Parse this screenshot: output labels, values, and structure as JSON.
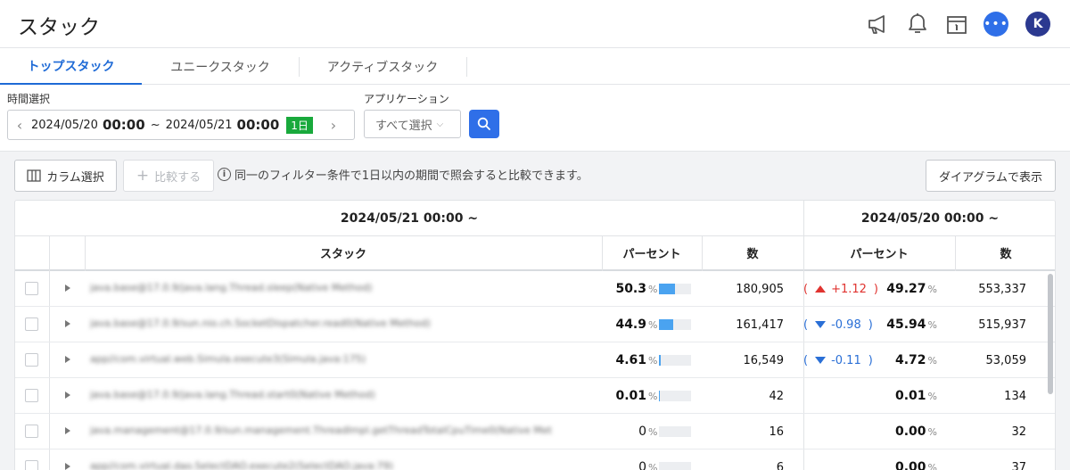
{
  "page_title": "スタック",
  "top_icons": [
    "megaphone-icon",
    "bell-icon",
    "calendar-icon",
    "chat-icon"
  ],
  "avatar_initial": "K",
  "tabs": [
    {
      "label": "トップスタック",
      "active": true
    },
    {
      "label": "ユニークスタック",
      "active": false
    },
    {
      "label": "アクティブスタック",
      "active": false
    }
  ],
  "filter": {
    "time_label": "時間選択",
    "start_date": "2024/05/20",
    "start_time": "00:00",
    "tilde": "~",
    "end_date": "2024/05/21",
    "end_time": "00:00",
    "range_badge": "1日",
    "app_label": "アプリケーション",
    "app_value": "すべて選択"
  },
  "toolbar": {
    "column_select": "カラム選択",
    "compare": "比較する",
    "info": "同一のフィルター条件で1日以内の期間で照会すると比較できます。",
    "diagram": "ダイアグラムで表示"
  },
  "table": {
    "current_group": "2024/05/21 00:00 ~",
    "previous_group": "2024/05/20 00:00 ~",
    "headers": {
      "stack": "スタック",
      "percent": "パーセント",
      "count": "数",
      "prev_percent": "パーセント",
      "prev_count": "数"
    },
    "pct_sign": "%",
    "rows": [
      {
        "stack": "java.base@17.0.9/java.lang.Thread.sleep(Native Method)",
        "percent": "50.3",
        "bar": 0.503,
        "count": "180,905",
        "diff": "+1.12",
        "dir": "up",
        "prev_percent": "49.27",
        "prev_count": "553,337"
      },
      {
        "stack": "java.base@17.0.9/sun.nio.ch.SocketDispatcher.read0(Native Method)",
        "percent": "44.9",
        "bar": 0.449,
        "count": "161,417",
        "diff": "-0.98",
        "dir": "down",
        "prev_percent": "45.94",
        "prev_count": "515,937"
      },
      {
        "stack": "app//com.virtual.web.Simula.execute3(Simula.java:175)",
        "percent": "4.61",
        "bar": 0.0461,
        "count": "16,549",
        "diff": "-0.11",
        "dir": "down",
        "prev_percent": "4.72",
        "prev_count": "53,059"
      },
      {
        "stack": "java.base@17.0.9/java.lang.Thread.start0(Native Method)",
        "percent": "0.01",
        "bar": 0.0001,
        "count": "42",
        "diff": "",
        "dir": "none",
        "prev_percent": "0.01",
        "prev_count": "134"
      },
      {
        "stack": "java.management@17.0.9/sun.management.ThreadImpl.getThreadTotalCpuTime0(Native Met",
        "percent": "0",
        "bar": 0,
        "count": "16",
        "diff": "",
        "dir": "none",
        "prev_percent": "0.00",
        "prev_count": "32"
      },
      {
        "stack": "app//com.virtual.dao.SelectDAO.execute2(SelectDAO.java:79)",
        "percent": "0",
        "bar": 0,
        "count": "6",
        "diff": "",
        "dir": "none",
        "prev_percent": "0.00",
        "prev_count": "37"
      }
    ]
  }
}
